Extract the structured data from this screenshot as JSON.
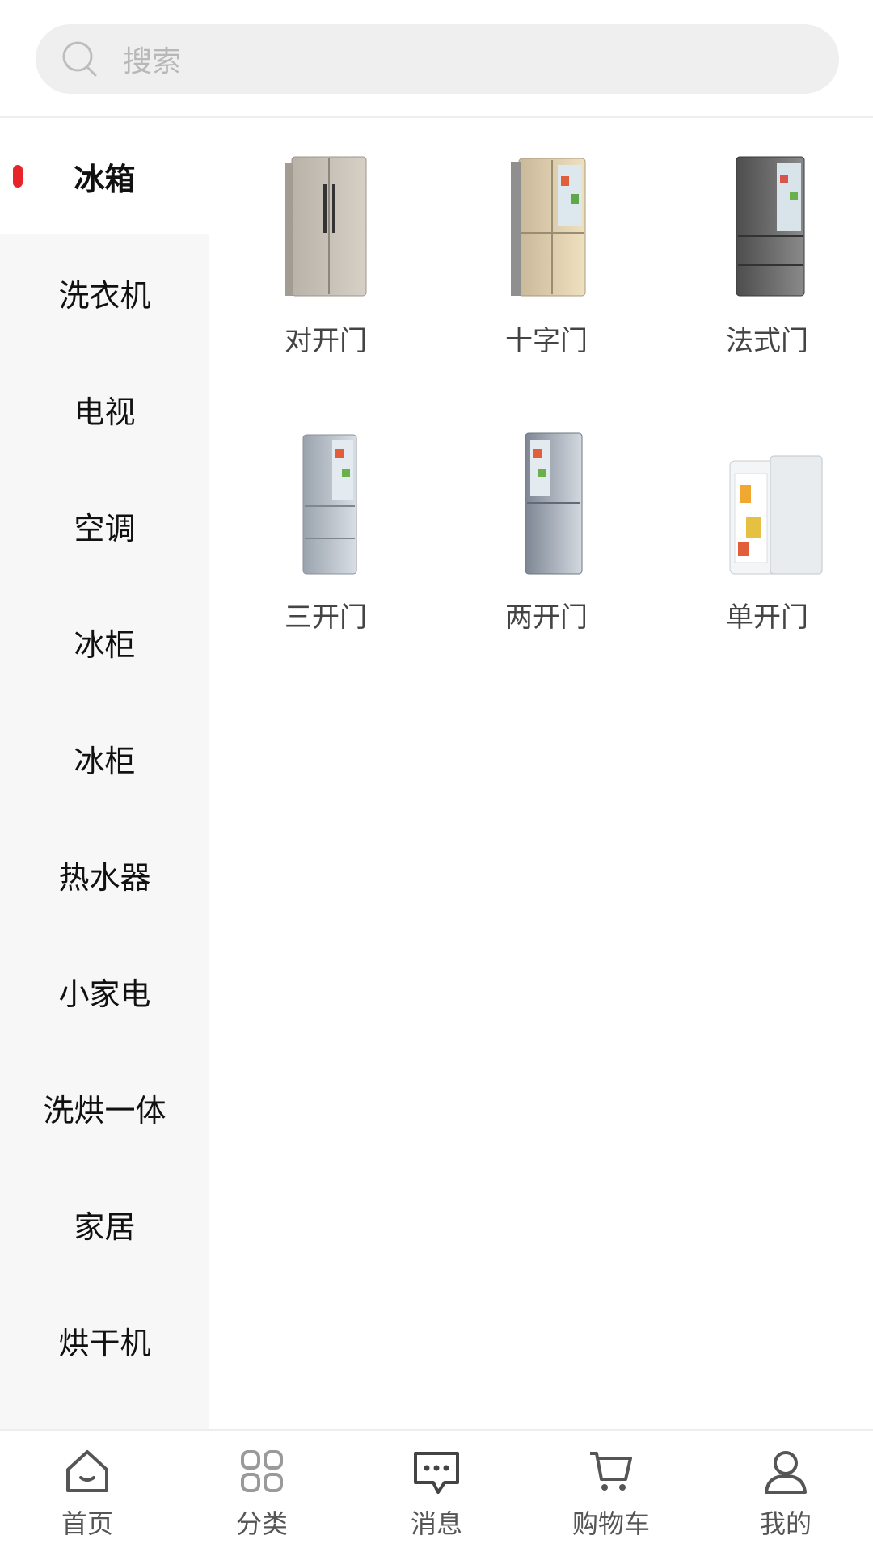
{
  "search": {
    "placeholder": "搜索"
  },
  "sidebar": {
    "items": [
      {
        "label": "冰箱",
        "active": true
      },
      {
        "label": "洗衣机"
      },
      {
        "label": "电视"
      },
      {
        "label": "空调"
      },
      {
        "label": "冰柜"
      },
      {
        "label": "冰柜"
      },
      {
        "label": "热水器"
      },
      {
        "label": "小家电"
      },
      {
        "label": "洗烘一体"
      },
      {
        "label": "家居"
      },
      {
        "label": "烘干机"
      }
    ]
  },
  "products": [
    {
      "label": "对开门",
      "icon": "side-by-side-fridge"
    },
    {
      "label": "十字门",
      "icon": "cross-door-fridge"
    },
    {
      "label": "法式门",
      "icon": "french-door-fridge"
    },
    {
      "label": "三开门",
      "icon": "three-door-fridge"
    },
    {
      "label": "两开门",
      "icon": "two-door-fridge"
    },
    {
      "label": "单开门",
      "icon": "single-door-fridge"
    }
  ],
  "tabbar": {
    "items": [
      {
        "label": "首页",
        "icon": "home-icon"
      },
      {
        "label": "分类",
        "icon": "category-icon"
      },
      {
        "label": "消息",
        "icon": "message-icon"
      },
      {
        "label": "购物车",
        "icon": "cart-icon"
      },
      {
        "label": "我的",
        "icon": "user-icon"
      }
    ]
  },
  "colors": {
    "accent": "#e8232a",
    "sidebar_bg": "#f7f7f7",
    "search_bg": "#efefef"
  }
}
